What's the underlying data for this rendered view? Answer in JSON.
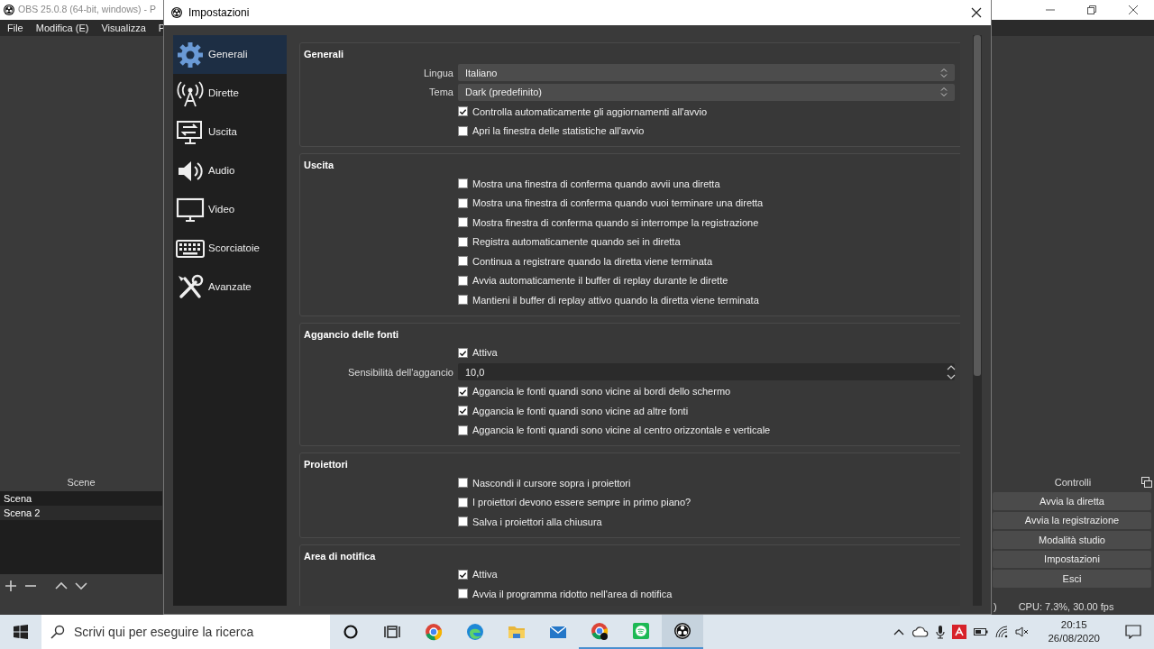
{
  "main_window": {
    "title": "OBS 25.0.8 (64-bit, windows) - P",
    "menu": [
      "File",
      "Modifica (E)",
      "Visualizza",
      "P"
    ],
    "scenes_panel": {
      "title": "Scene",
      "items": [
        "Scena",
        "Scena 2"
      ]
    },
    "controls_panel": {
      "title": "Controlli",
      "buttons": [
        "Avvia la diretta",
        "Avvia la registrazione",
        "Modalità studio",
        "Impostazioni",
        "Esci"
      ]
    },
    "status_bar": {
      "fragment": ")",
      "stats": "CPU: 7.3%, 30.00 fps"
    }
  },
  "dialog": {
    "title": "Impostazioni",
    "sidebar": [
      {
        "label": "Generali",
        "selected": true
      },
      {
        "label": "Dirette",
        "selected": false
      },
      {
        "label": "Uscita",
        "selected": false
      },
      {
        "label": "Audio",
        "selected": false
      },
      {
        "label": "Video",
        "selected": false
      },
      {
        "label": "Scorciatoie",
        "selected": false
      },
      {
        "label": "Avanzate",
        "selected": false
      }
    ],
    "sections": [
      {
        "title": "Generali",
        "rows": [
          {
            "kind": "select",
            "label": "Lingua",
            "value": "Italiano"
          },
          {
            "kind": "select",
            "label": "Tema",
            "value": "Dark (predefinito)"
          },
          {
            "kind": "checkbox",
            "label": "Controlla automaticamente gli aggiornamenti all'avvio",
            "checked": true
          },
          {
            "kind": "checkbox",
            "label": "Apri la finestra delle statistiche all'avvio",
            "checked": false
          }
        ]
      },
      {
        "title": "Uscita",
        "rows": [
          {
            "kind": "checkbox",
            "label": "Mostra una finestra di conferma quando avvii una diretta",
            "checked": false
          },
          {
            "kind": "checkbox",
            "label": "Mostra una finestra di conferma quando vuoi terminare una diretta",
            "checked": false
          },
          {
            "kind": "checkbox",
            "label": "Mostra finestra di conferma quando si interrompe la registrazione",
            "checked": false
          },
          {
            "kind": "checkbox",
            "label": "Registra automaticamente quando sei in diretta",
            "checked": false
          },
          {
            "kind": "checkbox",
            "label": "Continua a registrare quando la diretta viene terminata",
            "checked": false
          },
          {
            "kind": "checkbox",
            "label": "Avvia automaticamente il buffer di replay durante le dirette",
            "checked": false
          },
          {
            "kind": "checkbox",
            "label": "Mantieni il buffer di replay attivo quando la diretta viene terminata",
            "checked": false
          }
        ]
      },
      {
        "title": "Aggancio delle fonti",
        "rows": [
          {
            "kind": "checkbox",
            "label": "Attiva",
            "checked": true
          },
          {
            "kind": "spin",
            "label": "Sensibilità dell'aggancio",
            "value": "10,0"
          },
          {
            "kind": "checkbox",
            "label": "Aggancia le fonti quandi sono vicine ai bordi dello schermo",
            "checked": true
          },
          {
            "kind": "checkbox",
            "label": "Aggancia le fonti quandi sono vicine ad altre fonti",
            "checked": true
          },
          {
            "kind": "checkbox",
            "label": "Aggancia le fonti quandi sono vicine al centro orizzontale e verticale",
            "checked": false
          }
        ]
      },
      {
        "title": "Proiettori",
        "rows": [
          {
            "kind": "checkbox",
            "label": "Nascondi il cursore sopra i proiettori",
            "checked": false
          },
          {
            "kind": "checkbox",
            "label": "I proiettori devono essere sempre in primo piano?",
            "checked": false
          },
          {
            "kind": "checkbox",
            "label": "Salva i proiettori alla chiusura",
            "checked": false
          }
        ]
      },
      {
        "title": "Area di notifica",
        "rows": [
          {
            "kind": "checkbox",
            "label": "Attiva",
            "checked": true
          },
          {
            "kind": "checkbox",
            "label": "Avvia il programma ridotto nell'area di notifica",
            "checked": false
          }
        ]
      }
    ]
  },
  "taskbar": {
    "search_placeholder": "Scrivi qui per eseguire la ricerca",
    "time": "20:15",
    "date": "26/08/2020"
  }
}
